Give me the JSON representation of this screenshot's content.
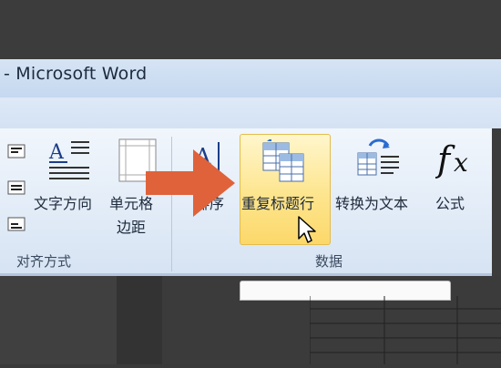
{
  "window": {
    "title": "- Microsoft Word"
  },
  "ribbon": {
    "alignment_group": {
      "label": "对齐方式",
      "text_direction": "文字方向",
      "cell_margins_line1": "单元格",
      "cell_margins_line2": "边距"
    },
    "data_group": {
      "label": "数据",
      "sort": "排序",
      "repeat_header_rows": "重复标题行",
      "convert_to_text": "转换为文本",
      "formula": "公式"
    }
  },
  "colors": {
    "ribbon_bg": "#e4edf8",
    "hover_highlight": "#fde58e",
    "arrow": "#e0623a",
    "title_bar": "#cfdff3"
  },
  "icons": [
    "align-icon",
    "text-direction-icon",
    "cell-margins-icon",
    "sort-icon",
    "repeat-header-rows-icon",
    "convert-to-text-icon",
    "formula-icon",
    "arrow-pointer-icon",
    "mouse-cursor-icon"
  ]
}
